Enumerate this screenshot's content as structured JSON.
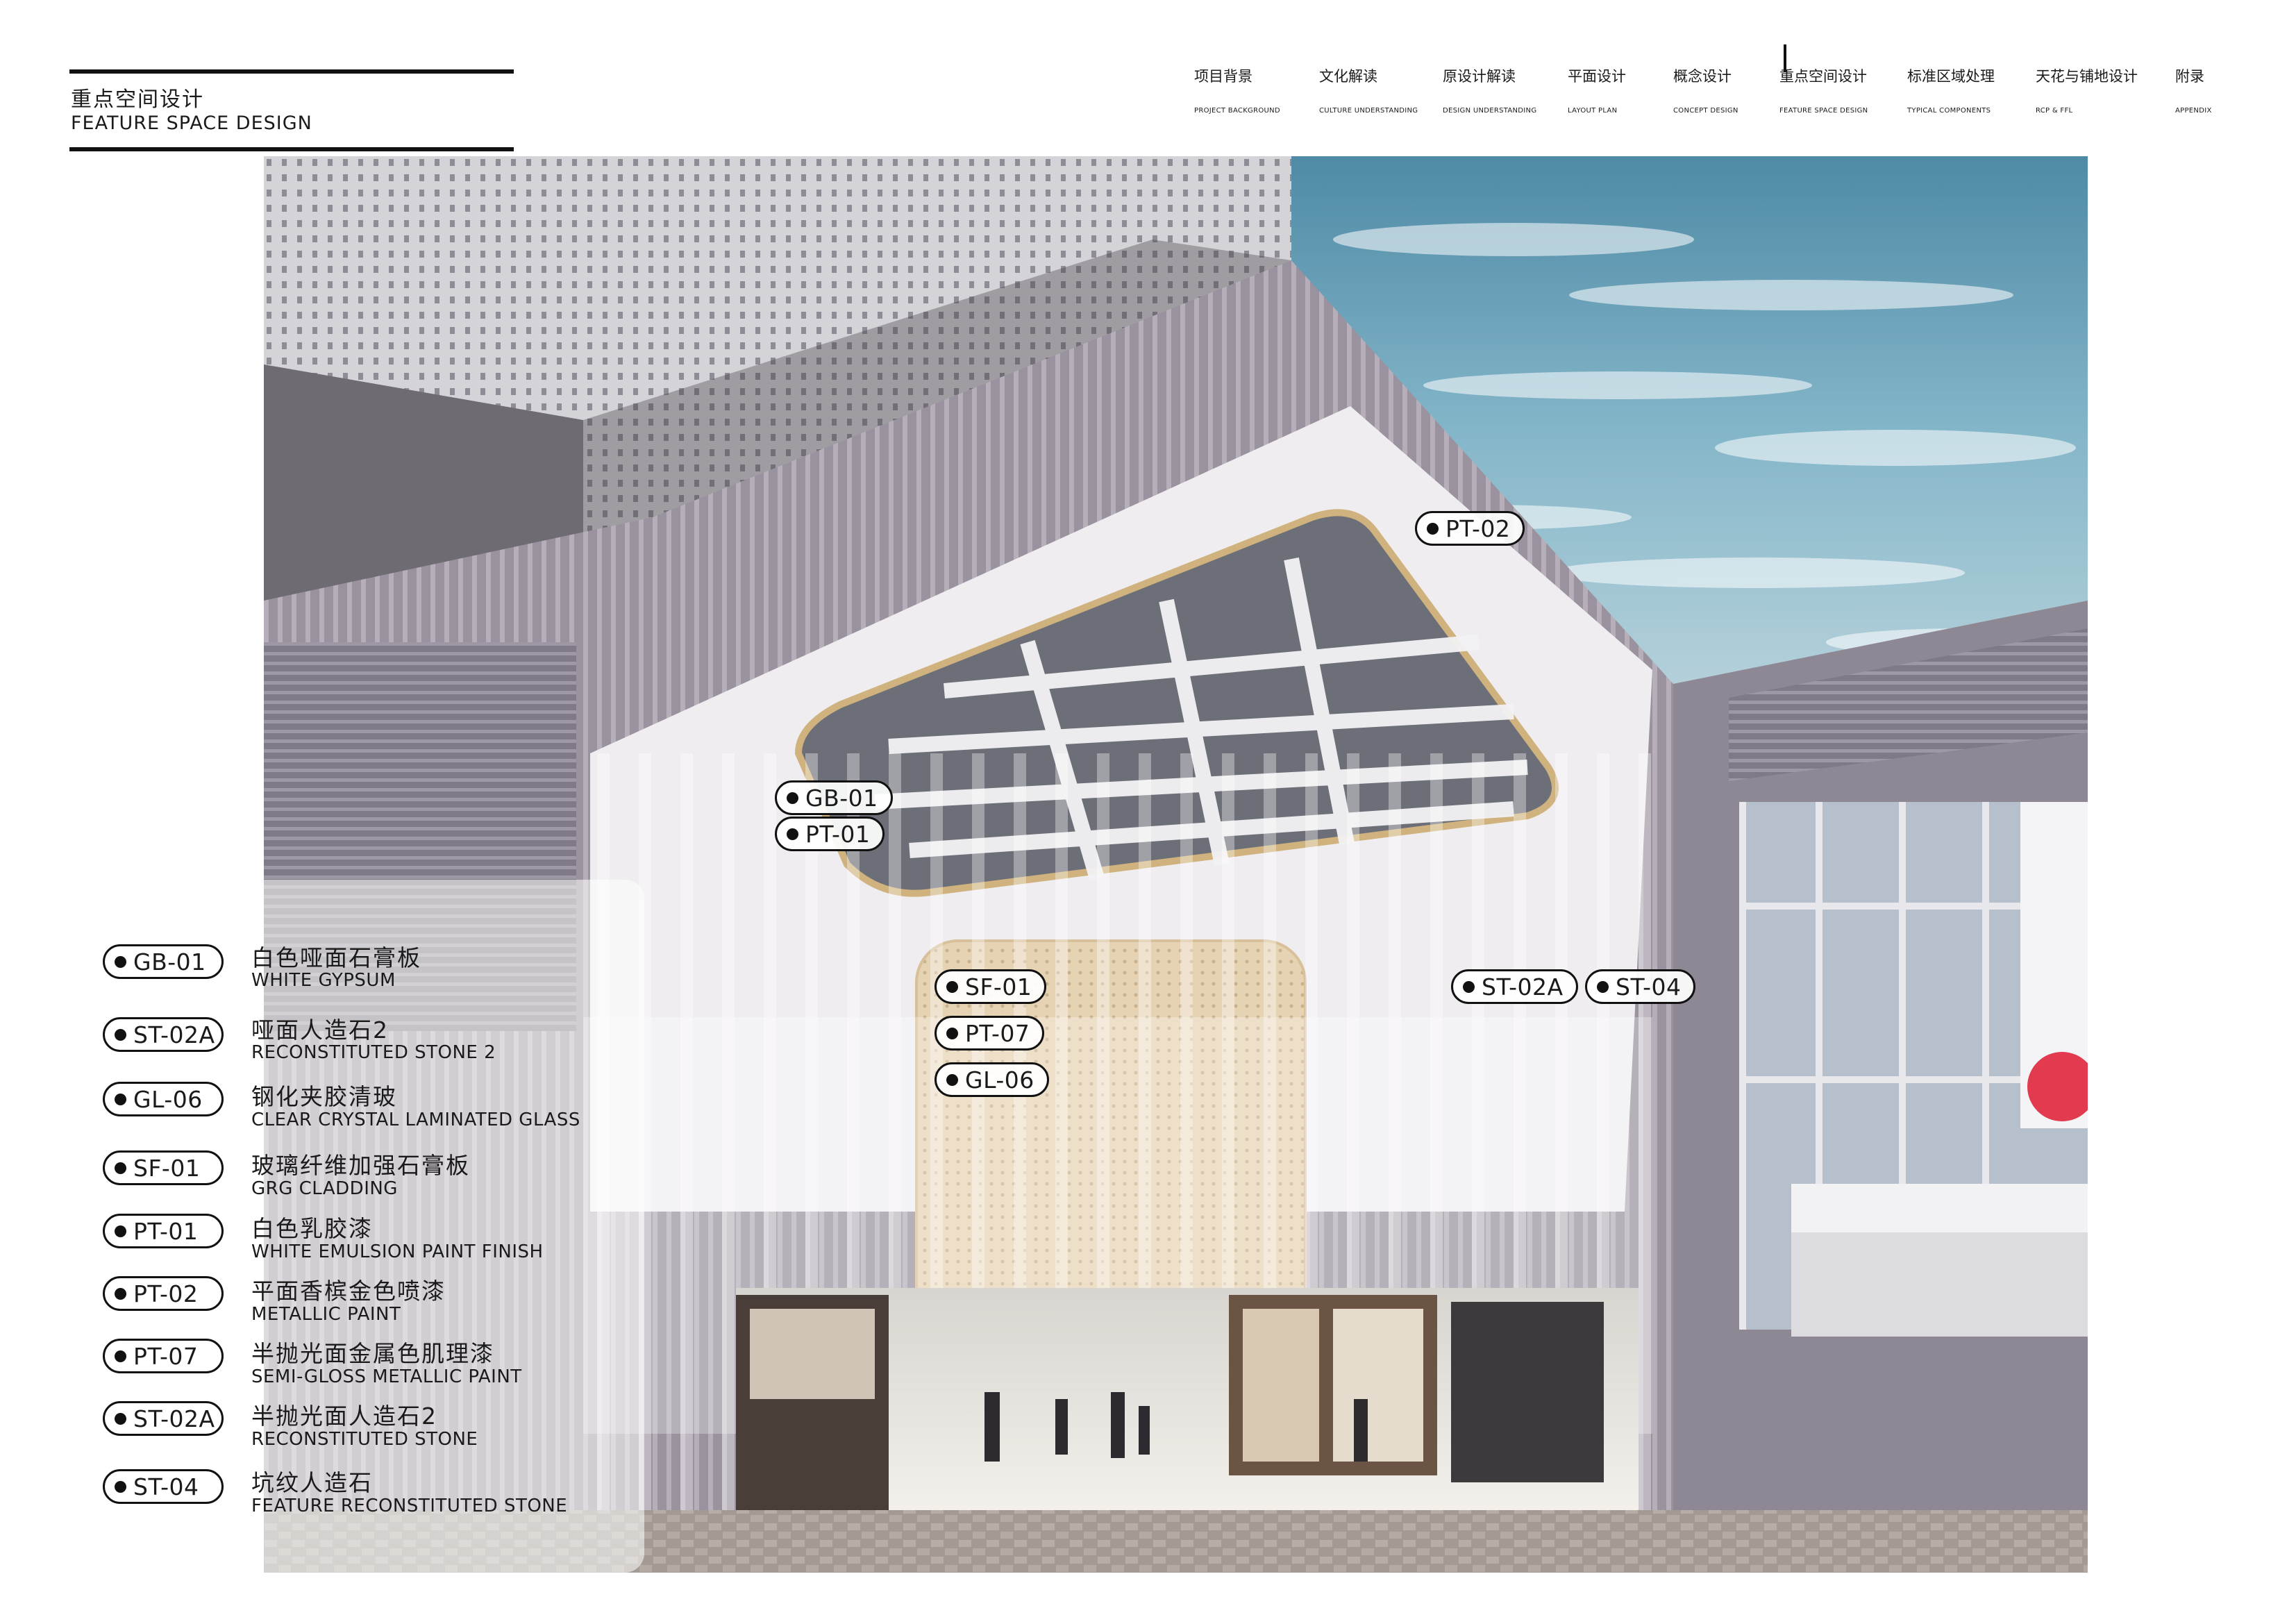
{
  "header": {
    "title_cn": "重点空间设计",
    "title_en": "FEATURE SPACE DESIGN"
  },
  "nav": [
    {
      "cn": "项目背景",
      "en": "PROJECT BACKGROUND"
    },
    {
      "cn": "文化解读",
      "en": "CULTURE UNDERSTANDING"
    },
    {
      "cn": "原设计解读",
      "en": "DESIGN UNDERSTANDING"
    },
    {
      "cn": "平面设计",
      "en": "LAYOUT PLAN"
    },
    {
      "cn": "概念设计",
      "en": "CONCEPT DESIGN"
    },
    {
      "cn": "重点空间设计",
      "en": "FEATURE SPACE DESIGN"
    },
    {
      "cn": "标准区域处理",
      "en": "TYPICAL COMPONENTS"
    },
    {
      "cn": "天花与铺地设计",
      "en": "RCP & FFL"
    },
    {
      "cn": "附录",
      "en": "APPENDIX"
    }
  ],
  "nav_active_index": 5,
  "legend": [
    {
      "code": "GB-01",
      "cn": "白色哑面石膏板",
      "en": "WHITE GYPSUM"
    },
    {
      "code": "ST-02A",
      "cn": "哑面人造石2",
      "en": "RECONSTITUTED STONE 2"
    },
    {
      "code": "GL-06",
      "cn": "钢化夹胶清玻",
      "en": "CLEAR CRYSTAL LAMINATED GLASS"
    },
    {
      "code": "SF-01",
      "cn": "玻璃纤维加强石膏板",
      "en": "GRG CLADDING"
    },
    {
      "code": "PT-01",
      "cn": "白色乳胶漆",
      "en": "WHITE EMULSION PAINT FINISH"
    },
    {
      "code": "PT-02",
      "cn": "平面香槟金色喷漆",
      "en": "METALLIC PAINT"
    },
    {
      "code": "PT-07",
      "cn": "半抛光面金属色肌理漆",
      "en": "SEMI-GLOSS METALLIC PAINT"
    },
    {
      "code": "ST-02A",
      "cn": "半抛光面人造石2",
      "en": "RECONSTITUTED STONE"
    },
    {
      "code": "ST-04",
      "cn": "坑纹人造石",
      "en": "FEATURE RECONSTITUTED STONE"
    }
  ],
  "callouts": [
    {
      "code": "PT-02"
    },
    {
      "code": "GB-01"
    },
    {
      "code": "PT-01"
    },
    {
      "code": "SF-01"
    },
    {
      "code": "PT-07"
    },
    {
      "code": "GL-06"
    },
    {
      "code": "ST-02A"
    },
    {
      "code": "ST-04"
    }
  ],
  "colors": {
    "sky": "#6fa8c0",
    "building_gray": "#8a8590",
    "white_cladding": "#ece9ee",
    "gold": "#d9c19a"
  }
}
